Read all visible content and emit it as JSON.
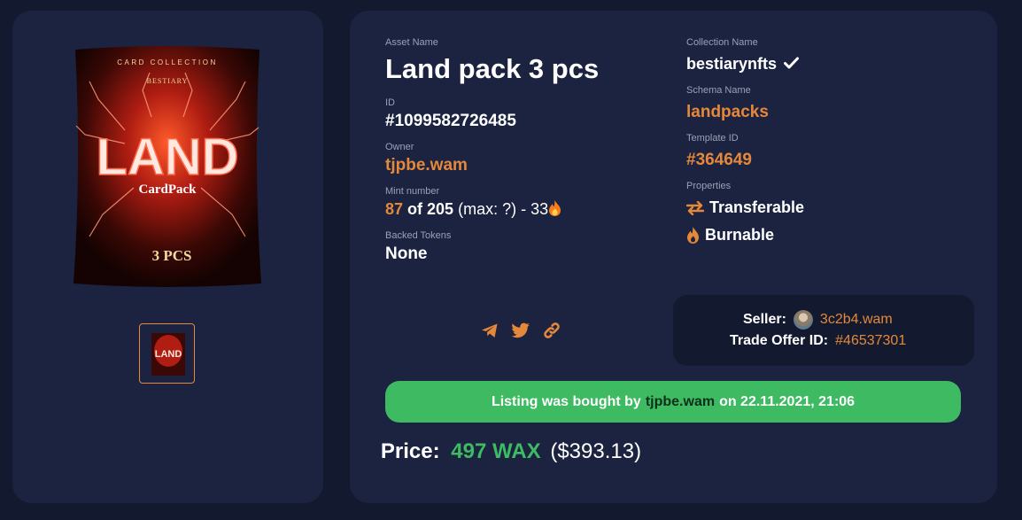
{
  "asset": {
    "name_label": "Asset Name",
    "name": "Land pack 3 pcs",
    "id_label": "ID",
    "id": "#1099582726485",
    "owner_label": "Owner",
    "owner": "tjpbe.wam",
    "mint_label": "Mint number",
    "mint_number": "87",
    "mint_of": "of 205",
    "mint_rest": "(max: ?) - 33",
    "backed_label": "Backed Tokens",
    "backed": "None"
  },
  "collection": {
    "collection_label": "Collection Name",
    "collection": "bestiarynfts",
    "schema_label": "Schema Name",
    "schema": "landpacks",
    "template_label": "Template ID",
    "template": "#364649",
    "properties_label": "Properties",
    "properties": [
      "Transferable",
      "Burnable"
    ]
  },
  "image": {
    "header": "CARD COLLECTION",
    "brand": "BESTIARY",
    "big": "LAND",
    "sub": "CardPack",
    "count": "3 PCS"
  },
  "seller": {
    "seller_label": "Seller:",
    "seller": "3c2b4.wam",
    "offer_label": "Trade Offer ID:",
    "offer_id": "#46537301"
  },
  "banner": {
    "prefix": "Listing was bought by",
    "buyer": "tjpbe.wam",
    "suffix": "on 22.11.2021, 21:06"
  },
  "price": {
    "label": "Price:",
    "wax": "497 WAX",
    "usd": "($393.13)"
  },
  "share_icons": [
    "telegram-icon",
    "twitter-icon",
    "link-icon"
  ],
  "colors": {
    "accent": "#e5883a",
    "success": "#3dba62",
    "panel": "#1b2340",
    "background": "#131a30"
  }
}
